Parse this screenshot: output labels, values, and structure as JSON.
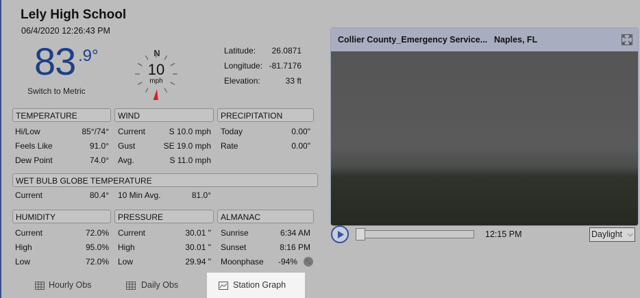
{
  "station": {
    "name": "Lely High School",
    "datetime": "06/4/2020 12:26:43 PM"
  },
  "current_temp": {
    "whole": "83",
    "decimal": ".9°",
    "switch_label": "Switch to Metric"
  },
  "wind_gauge": {
    "direction": "N",
    "speed": "10",
    "unit": "mph",
    "arrow_color": "#d42020"
  },
  "location": {
    "latitude_label": "Latitude:",
    "latitude": "26.0871",
    "longitude_label": "Longitude:",
    "longitude": "-81.7176",
    "elevation_label": "Elevation:",
    "elevation": "33 ft"
  },
  "temperature": {
    "title": "TEMPERATURE",
    "rows": [
      {
        "label": "Hi/Low",
        "value": "85°/74°"
      },
      {
        "label": "Feels Like",
        "value": "91.0°"
      },
      {
        "label": "Dew Point",
        "value": "74.0°"
      }
    ]
  },
  "wind": {
    "title": "WIND",
    "rows": [
      {
        "label": "Current",
        "value": "S 10.0 mph"
      },
      {
        "label": "Gust",
        "value": "SE 19.0 mph"
      },
      {
        "label": "Avg.",
        "value": "S 11.0 mph"
      }
    ]
  },
  "precipitation": {
    "title": "PRECIPITATION",
    "rows": [
      {
        "label": "Today",
        "value": "0.00\""
      },
      {
        "label": "Rate",
        "value": "0.00\""
      }
    ]
  },
  "wbgt": {
    "title": "WET BULB GLOBE TEMPERATURE",
    "current_label": "Current",
    "current_value": "80.4°",
    "avg_label": "10 Min Avg.",
    "avg_value": "81.0°"
  },
  "humidity": {
    "title": "HUMIDITY",
    "rows": [
      {
        "label": "Current",
        "value": "72.0%"
      },
      {
        "label": "High",
        "value": "95.0%"
      },
      {
        "label": "Low",
        "value": "72.0%"
      }
    ]
  },
  "pressure": {
    "title": "PRESSURE",
    "rows": [
      {
        "label": "Current",
        "value": "30.01 \""
      },
      {
        "label": "High",
        "value": "30.01 \""
      },
      {
        "label": "Low",
        "value": "29.94 \""
      }
    ]
  },
  "almanac": {
    "title": "ALMANAC",
    "rows": [
      {
        "label": "Sunrise",
        "value": "6:34 AM"
      },
      {
        "label": "Sunset",
        "value": "8:16 PM"
      },
      {
        "label": "Moonphase",
        "value": "-94%"
      }
    ]
  },
  "camera": {
    "location": "Collier County_Emergency Service...",
    "city": "Naples, FL",
    "time": "12:15 PM",
    "mode": "Daylight",
    "progress": 0
  },
  "tabs": [
    {
      "label": "Hourly Obs",
      "icon": "table-icon"
    },
    {
      "label": "Daily Obs",
      "icon": "table-icon"
    },
    {
      "label": "Station Graph",
      "icon": "chart-icon"
    }
  ],
  "colors": {
    "accent_blue": "#1d3f8a",
    "panel_grey": "#bcbcbc",
    "active_tab": "#f4f4f4"
  }
}
